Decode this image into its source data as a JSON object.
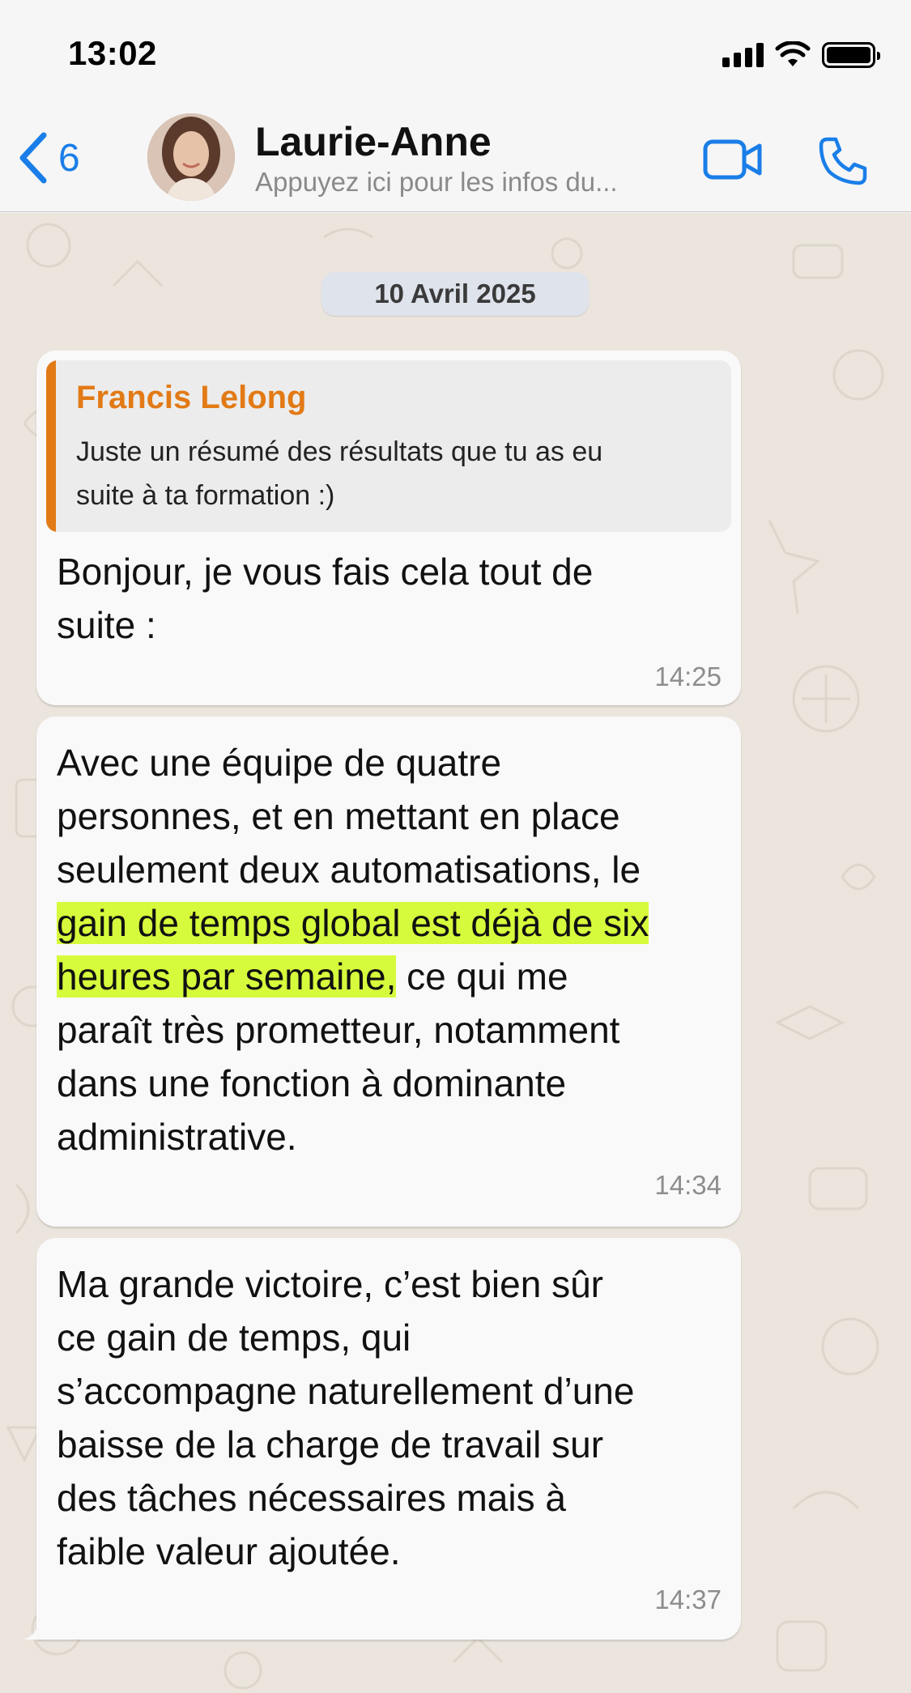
{
  "status_bar": {
    "time": "13:02"
  },
  "header": {
    "back_count": "6",
    "contact_name": "Laurie-Anne",
    "contact_subtitle": "Appuyez ici pour les infos du..."
  },
  "chat": {
    "date_separator": "10 Avril 2025",
    "messages": [
      {
        "quote_author": "Francis Lelong",
        "quote_text_line1": "Juste un résumé des résultats que tu as eu",
        "quote_text_line2": "suite à ta formation :)",
        "text_line1": "Bonjour, je vous fais cela tout de",
        "text_line2": "suite :",
        "time": "14:25"
      },
      {
        "line1": "Avec une équipe de quatre",
        "line2": "personnes, et en mettant en place",
        "line3": "seulement deux automatisations, le",
        "line4_highlight": "gain de temps global est déjà de six",
        "line5_highlight": "heures par semaine,",
        "line5_rest": " ce qui me",
        "line6": "paraît très prometteur, notamment",
        "line7": "dans une fonction à dominante",
        "line8": "administrative.",
        "time": "14:34"
      },
      {
        "line1": "Ma grande victoire, c’est bien sûr",
        "line2": "ce gain de temps, qui",
        "line3": "s’accompagne naturellement d’une",
        "line4": "baisse de la charge de travail sur",
        "line5": "des tâches nécessaires mais à",
        "line6": "faible valeur ajoutée.",
        "time": "14:37"
      }
    ]
  },
  "colors": {
    "accent": "#1a7ee8",
    "quote_accent": "#e27a16",
    "highlight": "#d6fb3c",
    "chat_bg": "#ebe5dd"
  },
  "icons": [
    "chevron-left-icon",
    "video-camera-icon",
    "phone-icon",
    "signal-icon",
    "wifi-icon",
    "battery-icon"
  ]
}
